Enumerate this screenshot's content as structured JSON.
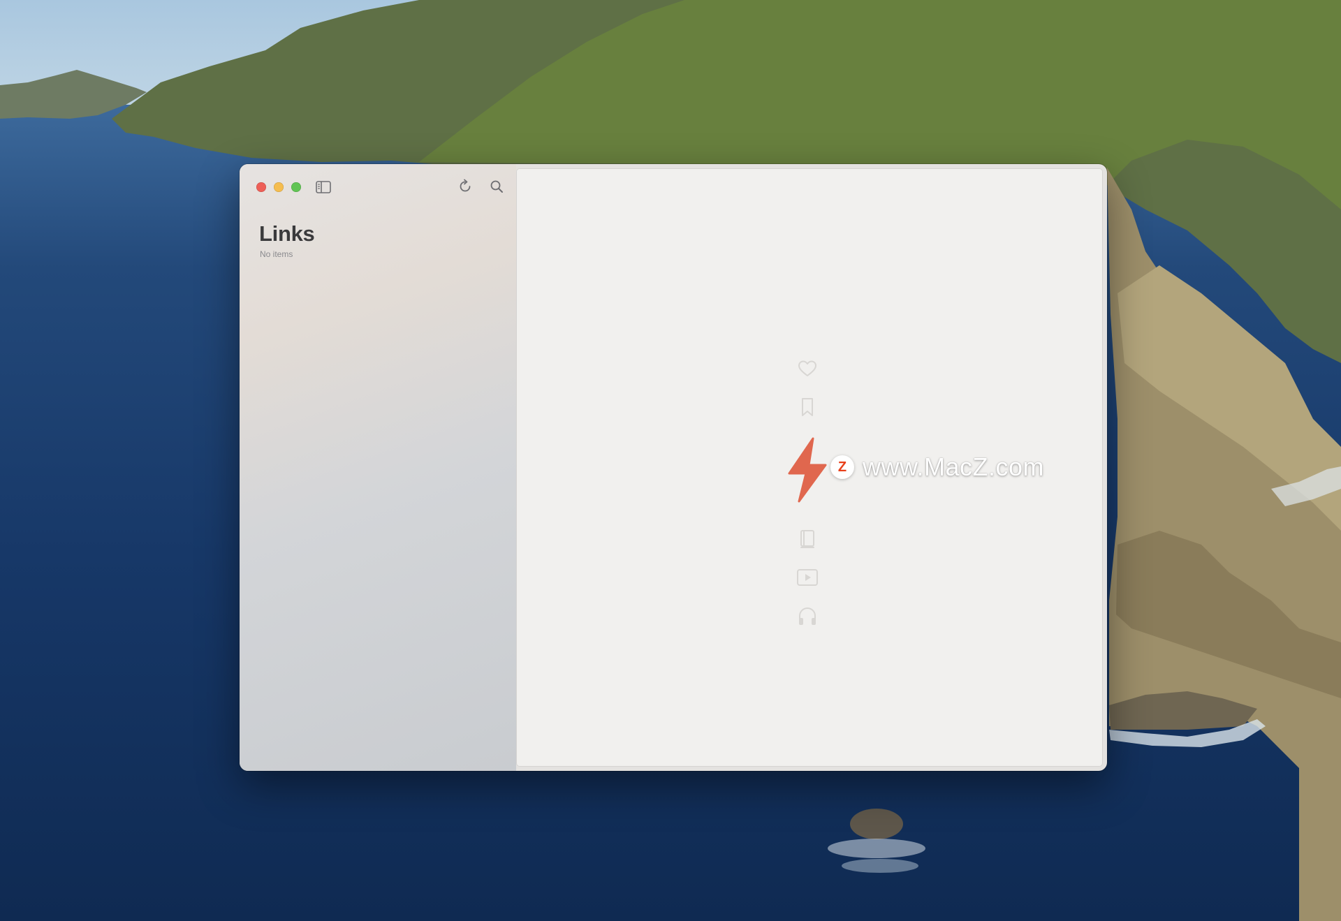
{
  "sidebar": {
    "title": "Links",
    "subtitle": "No items"
  },
  "toolbar": {
    "traffic_lights": [
      "close",
      "minimize",
      "zoom"
    ],
    "icons": [
      "sidebar-toggle-icon",
      "refresh-icon",
      "search-icon"
    ]
  },
  "content": {
    "empty_state_icons": [
      "heart-icon",
      "bookmark-icon",
      "lightning-bolt-icon",
      "book-icon",
      "video-play-icon",
      "headphones-icon"
    ],
    "accent_color": "#e0674e",
    "icon_color": "#d8d6d3"
  },
  "watermark": {
    "badge": "Z",
    "text": "www.MacZ.com"
  }
}
